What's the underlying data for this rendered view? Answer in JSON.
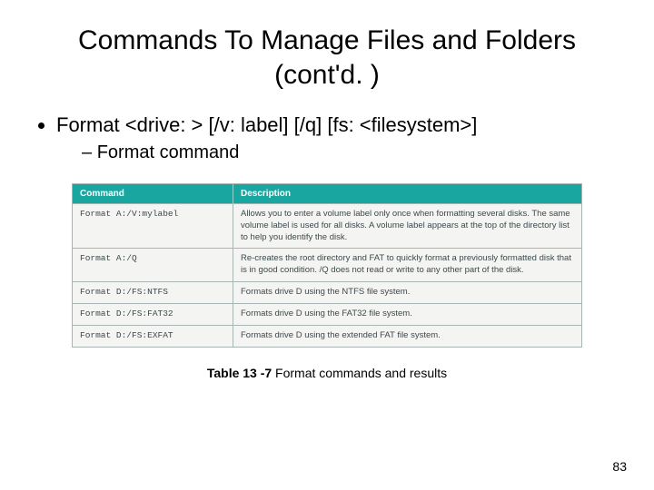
{
  "title": "Commands To Manage Files and Folders (cont'd. )",
  "bullets": {
    "main": "Format <drive: > [/v: label] [/q] [fs: <filesystem>]",
    "sub": "Format command"
  },
  "table": {
    "headers": {
      "col1": "Command",
      "col2": "Description"
    },
    "rows": [
      {
        "cmd": "Format A:/V:mylabel",
        "desc": "Allows you to enter a volume label only once when formatting several disks. The same volume label is used for all disks. A volume label appears at the top of the directory list to help you identify the disk."
      },
      {
        "cmd": "Format A:/Q",
        "desc": "Re-creates the root directory and FAT to quickly format a previously formatted disk that is in good condition. /Q does not read or write to any other part of the disk."
      },
      {
        "cmd": "Format D:/FS:NTFS",
        "desc": "Formats drive D using the NTFS file system."
      },
      {
        "cmd": "Format D:/FS:FAT32",
        "desc": "Formats drive D using the FAT32 file system."
      },
      {
        "cmd": "Format D:/FS:EXFAT",
        "desc": "Formats drive D using the extended FAT file system."
      }
    ]
  },
  "caption": {
    "strong": "Table 13 -7",
    "rest": " Format commands and results"
  },
  "page_number": "83"
}
